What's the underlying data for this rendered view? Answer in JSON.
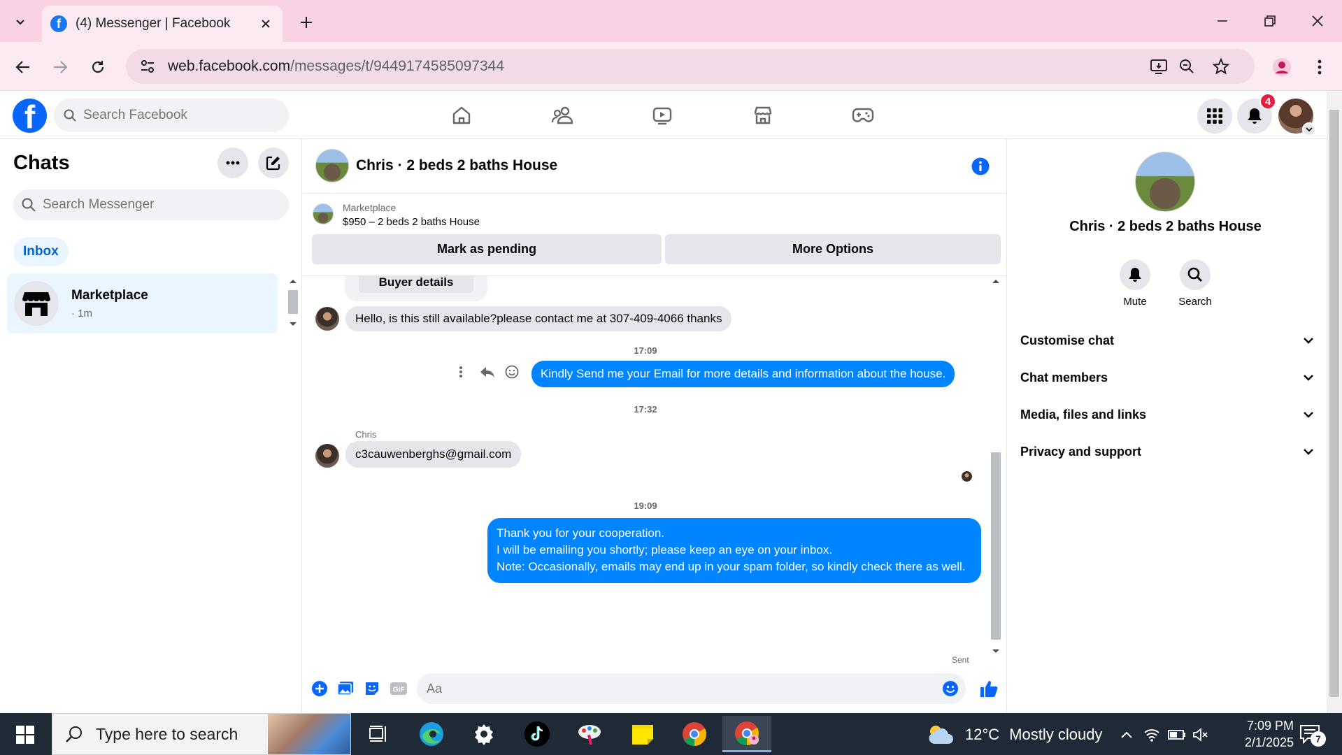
{
  "browser": {
    "tab_title": "(4) Messenger | Facebook",
    "url_host": "web.facebook.com",
    "url_path": "/messages/t/9449174585097344"
  },
  "facebook_header": {
    "search_placeholder": "Search Facebook",
    "notification_count": "4",
    "nav_icons": [
      "home-icon",
      "friends-icon",
      "watch-icon",
      "marketplace-icon",
      "gaming-icon"
    ]
  },
  "sidebar": {
    "title": "Chats",
    "search_placeholder": "Search Messenger",
    "filter_pill": "Inbox",
    "chats": [
      {
        "name": "Marketplace",
        "time": "· 1m"
      }
    ]
  },
  "conversation": {
    "title": "Chris · 2 beds 2 baths House",
    "marketplace": {
      "label": "Marketplace",
      "item": "$950 – 2 beds 2 baths House",
      "mark_pending": "Mark as pending",
      "more_options": "More Options"
    },
    "buyer_details_button": "Buyer details",
    "messages": {
      "incoming_1": "Hello, is this still available?please contact me at 307-409-4066 thanks",
      "timestamp_1": "17:09",
      "outgoing_1": "Kindly Send me your Email for more details and information about the house.",
      "timestamp_2": "17:32",
      "sender_name": "Chris",
      "incoming_2": "c3cauwenberghs@gmail.com",
      "timestamp_3": "19:09",
      "outgoing_2_line1": "Thank you for your cooperation.",
      "outgoing_2_line2": "I will be emailing you shortly; please keep an eye on your inbox.",
      "outgoing_2_line3": "Note: Occasionally, emails may end up in your spam folder, so kindly check there as well.",
      "status": "Sent"
    },
    "composer_placeholder": "Aa"
  },
  "info_panel": {
    "name": "Chris · 2 beds 2 baths House",
    "actions": [
      {
        "label": "Mute",
        "icon": "bell-icon"
      },
      {
        "label": "Search",
        "icon": "search-icon"
      }
    ],
    "sections": [
      "Customise chat",
      "Chat members",
      "Media, files and links",
      "Privacy and support"
    ]
  },
  "taskbar": {
    "search_placeholder": "Type here to search",
    "weather_temp": "12°C",
    "weather_desc": "Mostly cloudy",
    "time": "7:09 PM",
    "date": "2/1/2025",
    "notification_count": "7"
  },
  "colors": {
    "messenger_blue": "#0084ff",
    "facebook_blue": "#0866ff",
    "tabstrip_pink": "#f9d2e4",
    "taskbar": "#1f2a36"
  }
}
